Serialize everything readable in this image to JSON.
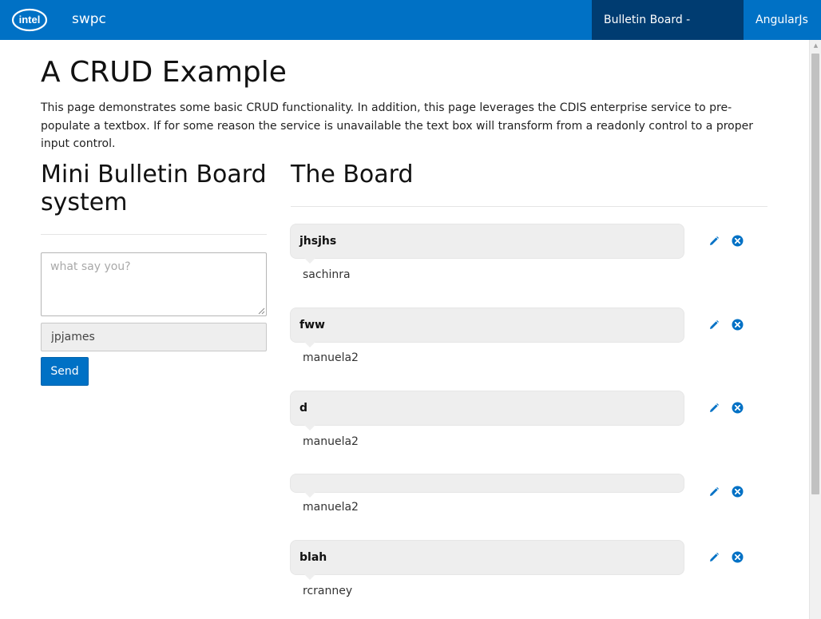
{
  "header": {
    "brand": "swpc",
    "logo_text": "intel",
    "nav": [
      {
        "label": "Bulletin Board - Sample",
        "active": true
      },
      {
        "label": "AngularJs",
        "active": false
      }
    ],
    "colors": {
      "bar": "#0071c5",
      "active": "#003c71"
    }
  },
  "page": {
    "title": "A CRUD Example",
    "intro": "This page demonstrates some basic CRUD functionality. In addition, this page leverages the CDIS enterprise service to pre-populate a textbox. If for some reason the service is unavailable the text box will transform from a readonly control to a proper input control."
  },
  "form": {
    "heading": "Mini Bulletin Board system",
    "message_placeholder": "what say you?",
    "message_value": "",
    "user_value": "jpjames",
    "send_label": "Send"
  },
  "board": {
    "heading": "The Board",
    "posts": [
      {
        "message": "jhsjhs",
        "author": "sachinra"
      },
      {
        "message": "fww",
        "author": "manuela2"
      },
      {
        "message": "d",
        "author": "manuela2"
      },
      {
        "message": "",
        "author": "manuela2"
      },
      {
        "message": "blah",
        "author": "rcranney"
      }
    ],
    "icons": {
      "edit": "pencil-icon",
      "delete": "close-circle-icon"
    }
  }
}
